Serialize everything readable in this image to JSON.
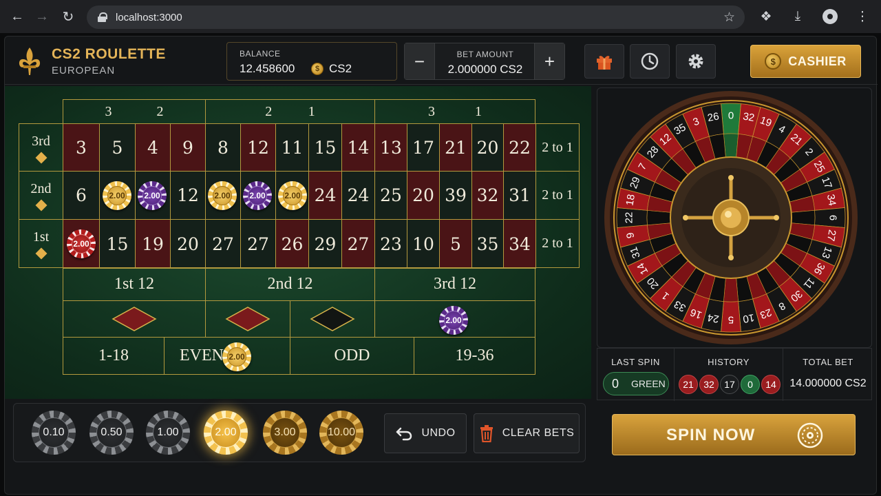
{
  "browser": {
    "url": "localhost:3000"
  },
  "header": {
    "title": "CS2 ROULETTE",
    "subtitle": "EUROPEAN",
    "balance_label": "BALANCE",
    "balance_value": "12.458600",
    "balance_currency": "CS2",
    "bet_label": "BET AMOUNT",
    "bet_value": "2.000000 CS2",
    "cashier_label": "CASHIER",
    "colors": {
      "accent": "#e4b458",
      "felt": "#1c4a2e",
      "red": "#4a1416"
    }
  },
  "table": {
    "top_groups": [
      {
        "a": "3",
        "b": "2"
      },
      {
        "a": "2",
        "b": "1"
      },
      {
        "a": "3",
        "b": "1"
      }
    ],
    "row_labels": [
      "3rd",
      "2nd",
      "1st"
    ],
    "rows": [
      [
        "3",
        "5",
        "4",
        "9",
        "8",
        "12",
        "11",
        "15",
        "14",
        "13",
        "17",
        "21",
        "20",
        "22"
      ],
      [
        "6",
        "",
        "",
        "12",
        "",
        "",
        "",
        "24",
        "24",
        "25",
        "20",
        "39",
        "32",
        "31"
      ],
      [
        "",
        "15",
        "19",
        "20",
        "27",
        "27",
        "26",
        "29",
        "27",
        "23",
        "10",
        "5",
        "35",
        "34"
      ]
    ],
    "column_bet": "2 to 1",
    "dozens": [
      "1st 12",
      "2nd 12",
      "3rd 12"
    ],
    "outside": [
      "1-18",
      "EVEN",
      "ODD",
      "19-36"
    ],
    "chip_value": "2.00"
  },
  "rack": {
    "chips": [
      "0.10",
      "0.50",
      "1.00",
      "2.00",
      "3.00",
      "10.00"
    ],
    "selected": "2.00",
    "undo_label": "UNDO",
    "clear_label": "CLEAR BETS"
  },
  "wheel": {
    "numbers": [
      "0",
      "32",
      "19",
      "4",
      "21",
      "2",
      "25",
      "17",
      "34",
      "6",
      "27",
      "13",
      "36",
      "11",
      "30",
      "8",
      "23",
      "10",
      "5",
      "24",
      "16",
      "33",
      "1",
      "20",
      "14",
      "31",
      "9",
      "22",
      "18",
      "29",
      "7",
      "28",
      "12",
      "35",
      "3",
      "26"
    ]
  },
  "stats": {
    "last_spin_label": "LAST SPIN",
    "last_spin_number": "0",
    "last_spin_color": "GREEN",
    "history_label": "HISTORY",
    "history": [
      "21",
      "32",
      "17",
      "0",
      "14"
    ],
    "total_bet_label": "TOTAL BET",
    "total_bet_value": "14.000000 CS2"
  },
  "spin_label": "SPIN NOW"
}
